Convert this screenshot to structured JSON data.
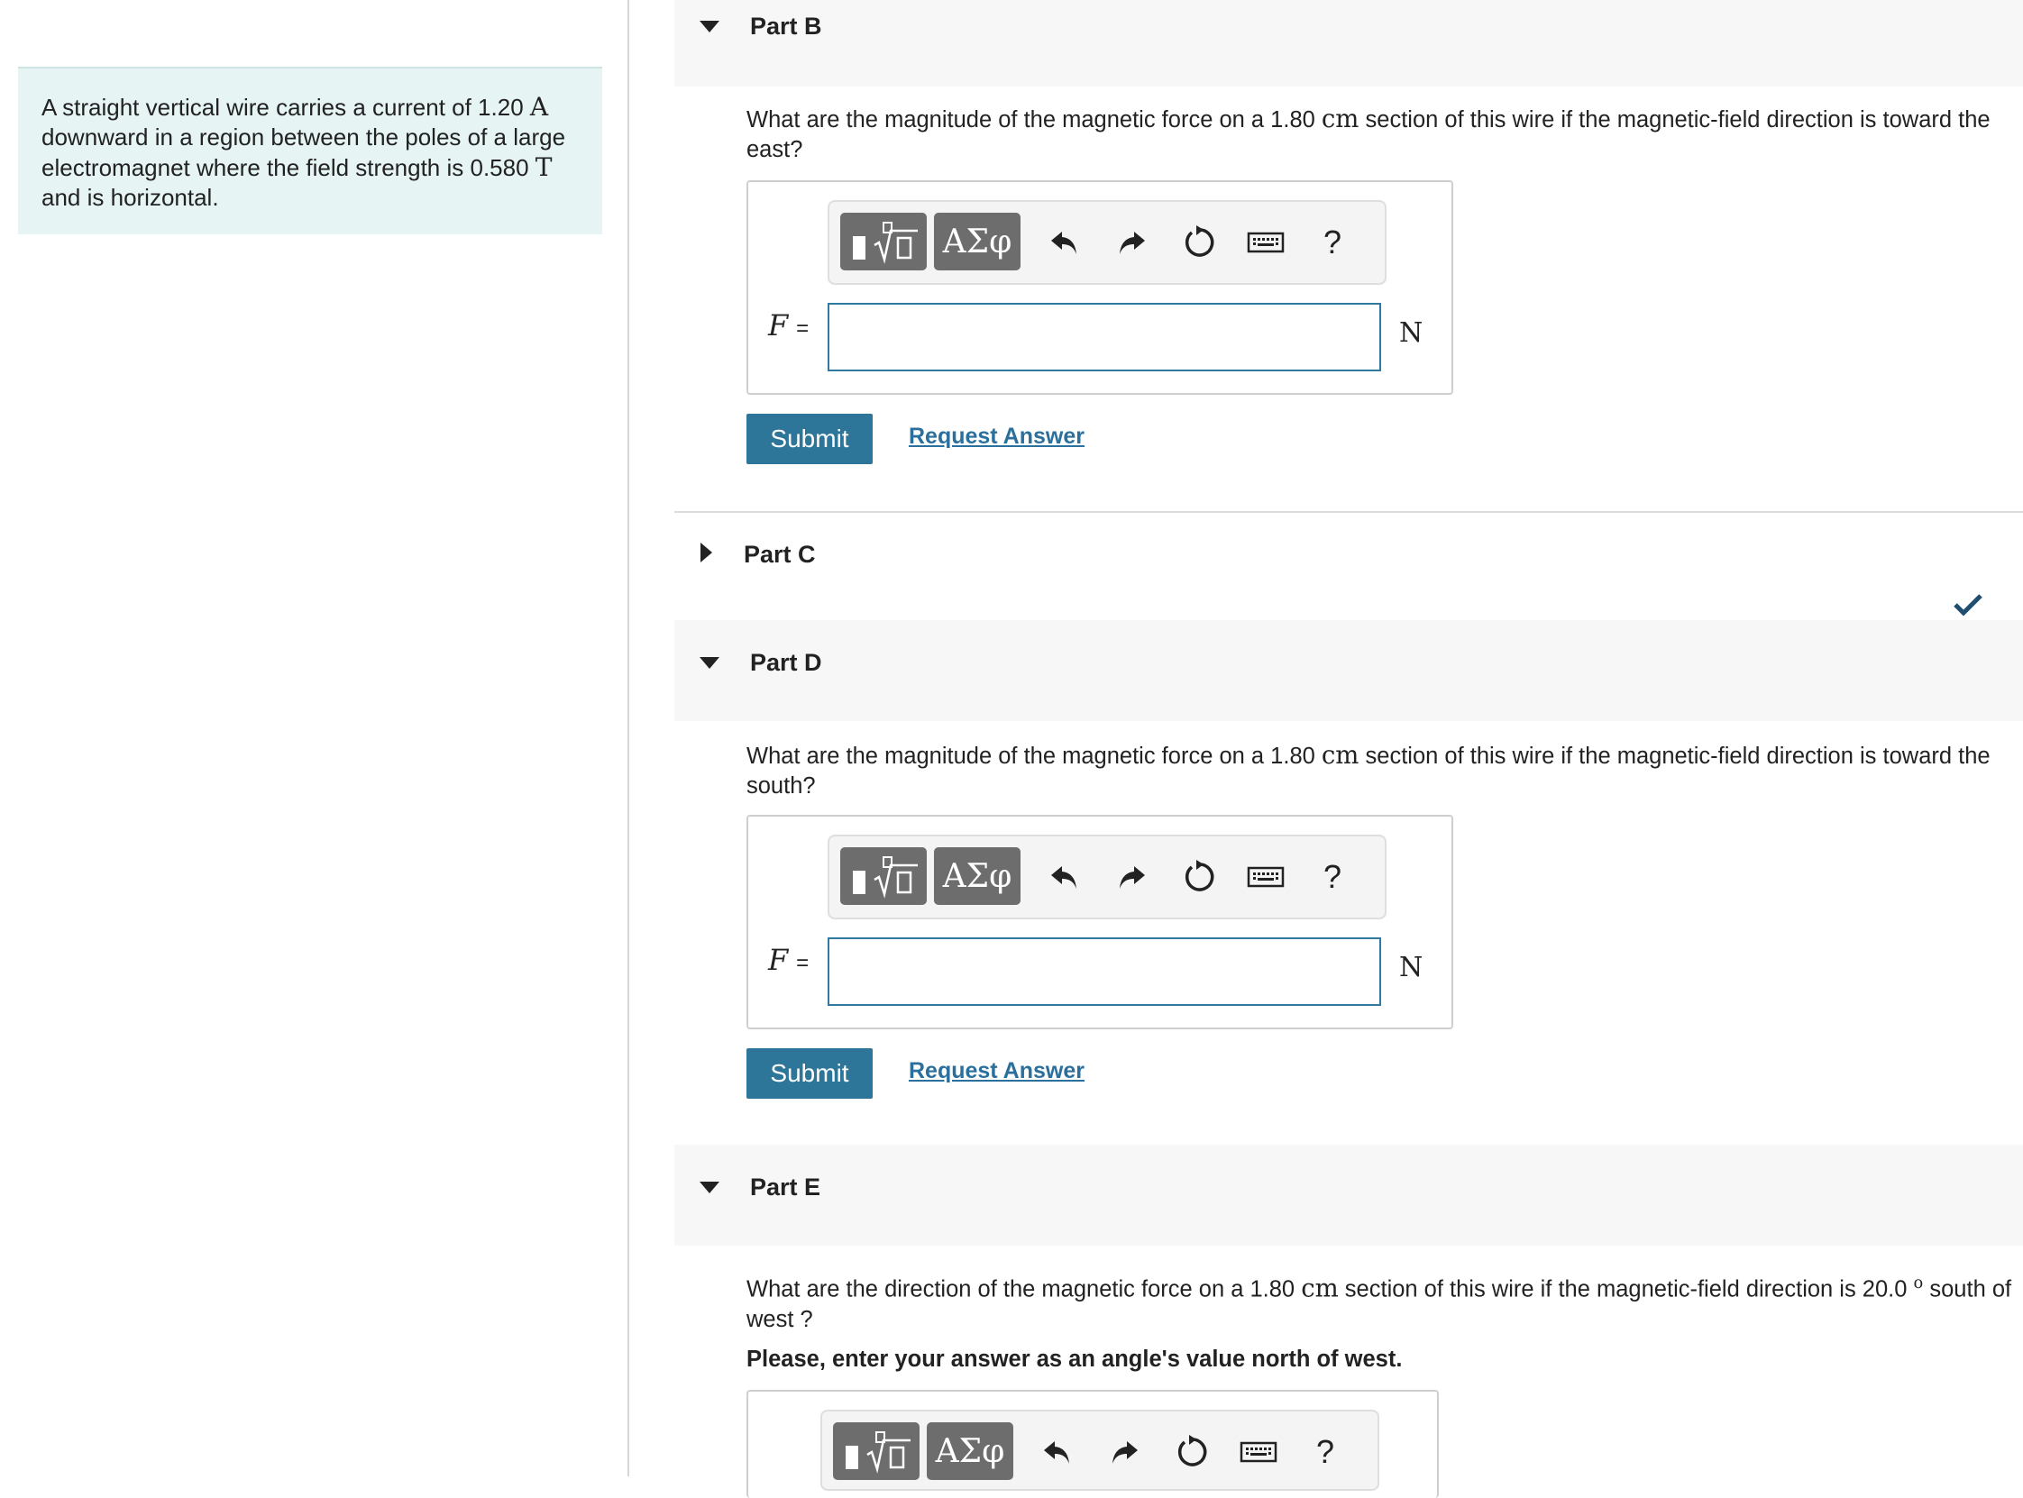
{
  "problem": {
    "statement": [
      {
        "t": "A straight vertical wire carries a current of 1.20 "
      },
      {
        "t": "A",
        "serif": true
      },
      {
        "t": " downward in a region between the poles of a large electromagnet where the field strength is 0.580 "
      },
      {
        "t": "T",
        "serif": true
      },
      {
        "t": " and is horizontal."
      }
    ]
  },
  "toolbar": {
    "greek_label": "ΑΣφ",
    "help_label": "?",
    "icons": [
      "templates-icon",
      "undo-icon",
      "redo-icon",
      "reset-icon",
      "keyboard-icon",
      "help-icon"
    ]
  },
  "parts": {
    "b": {
      "title": "Part B",
      "expanded": true,
      "question": [
        {
          "t": "What are the magnitude of the magnetic force on a 1.80 "
        },
        {
          "t": "cm",
          "serif": true
        },
        {
          "t": " section of this wire if the magnetic-field direction is toward the east?"
        }
      ],
      "variable": "F",
      "equals": "=",
      "unit": "N",
      "input_value": "",
      "submit_label": "Submit",
      "request_label": "Request Answer"
    },
    "c": {
      "title": "Part C",
      "expanded": false,
      "completed": true
    },
    "d": {
      "title": "Part D",
      "expanded": true,
      "question": [
        {
          "t": "What are the magnitude of the magnetic force on a 1.80 "
        },
        {
          "t": "cm",
          "serif": true
        },
        {
          "t": " section of this wire if the magnetic-field direction is toward the south?"
        }
      ],
      "variable": "F",
      "equals": "=",
      "unit": "N",
      "input_value": "",
      "submit_label": "Submit",
      "request_label": "Request Answer"
    },
    "e": {
      "title": "Part E",
      "expanded": true,
      "question": [
        {
          "t": "What are the direction of the magnetic force on a 1.80 "
        },
        {
          "t": "cm",
          "serif": true
        },
        {
          "t": " section of this wire if the magnetic-field direction is 20.0 "
        },
        {
          "t": "o",
          "sup": true
        },
        {
          "t": " south of west ?"
        }
      ],
      "instruction": "Please, enter your answer as an angle's value north of west."
    }
  },
  "colors": {
    "problem_bg": "#e6f4f4",
    "submit_bg": "#2e7699",
    "link": "#2b6f9c",
    "input_border": "#2f7aa0",
    "check": "#1f4e6e"
  }
}
